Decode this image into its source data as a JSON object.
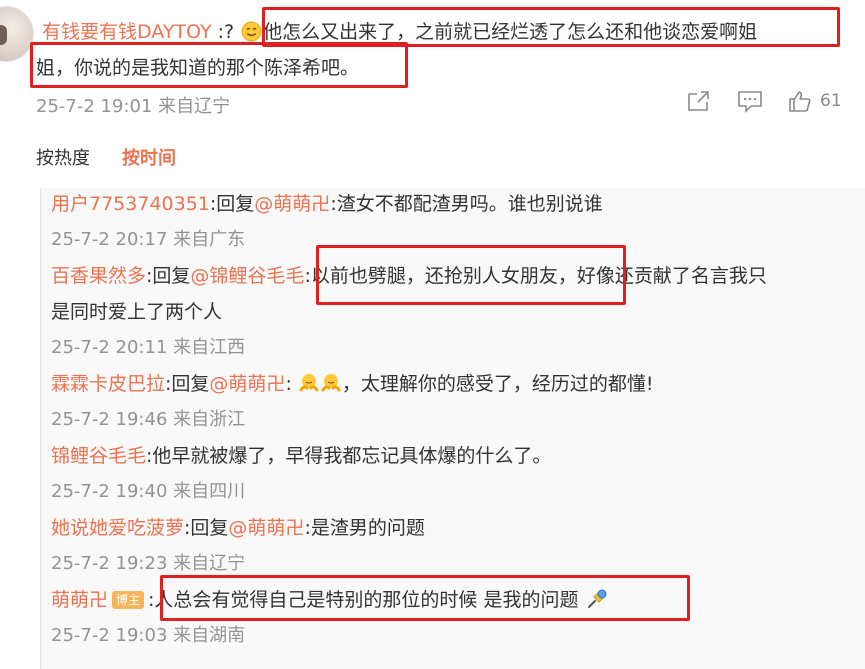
{
  "main_comment": {
    "username": "有钱要有钱DAYTOY",
    "prefix": ":?",
    "line1": "他怎么又出来了，之前就已经烂透了怎么还和他谈恋爱啊姐",
    "line2": "姐，你说的是我知道的那个陈泽希吧。",
    "meta": "25-7-2 19:01 来自辽宁",
    "like_count": "61",
    "icons": [
      "share-icon",
      "comment-icon",
      "like-icon"
    ]
  },
  "tabs": {
    "hot": "按热度",
    "time": "按时间",
    "active": "time"
  },
  "replies": [
    {
      "user": "用户7753740351",
      "reply_prefix": ":回复",
      "mention": "@萌萌卍",
      "text": ":渣女不都配渣男吗。谁也别说谁",
      "meta": "25-7-2 20:17 来自广东"
    },
    {
      "user": "百香果然多",
      "reply_prefix": ":回复",
      "mention": "@锦鲤谷毛毛",
      "text_a": ":以前也劈腿，还抢别人女朋友，",
      "text_b": "好像还贡献了名言我只",
      "text_line2": "是同时爱上了两个人",
      "meta": "25-7-2 20:11 来自江西"
    },
    {
      "user": "霖霖卡皮巴拉",
      "reply_prefix": ":回复",
      "mention": "@萌萌卍",
      "text": "，太理解你的感受了，经历过的都懂!",
      "emoji": "hug-emoji",
      "meta": "25-7-2 19:46 来自浙江"
    },
    {
      "user": "锦鲤谷毛毛",
      "text": ":他早就被爆了，早得我都忘记具体爆的什么了。",
      "meta": "25-7-2 19:40 来自四川"
    },
    {
      "user": "她说她爱吃菠萝",
      "reply_prefix": ":回复",
      "mention": "@萌萌卍",
      "text": ":是渣男的问题",
      "meta": "25-7-2 19:23 来自辽宁"
    },
    {
      "user": "萌萌卍",
      "badge": "博主",
      "text": ":人总会有觉得自己是特别的那位的时候 是我的问题",
      "emoji": "thumbtack-emoji",
      "meta": "25-7-2 19:03 来自湖南"
    }
  ],
  "colors": {
    "username": "#eb7350",
    "highlight_box": "#e02020",
    "meta": "#939393",
    "badge": "#f7b55a"
  }
}
